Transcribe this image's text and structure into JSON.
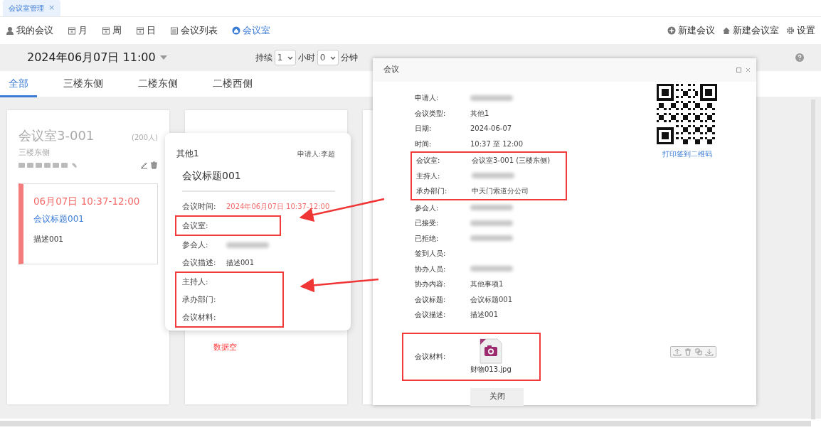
{
  "app_tabs": [
    {
      "label": "会议室管理",
      "close": "×",
      "selected": true
    }
  ],
  "toolbar": {
    "left": [
      {
        "label": "我的会议",
        "selected": false
      },
      {
        "label": "月",
        "selected": false
      },
      {
        "label": "周",
        "selected": false
      },
      {
        "label": "日",
        "selected": false
      },
      {
        "label": "会议列表",
        "selected": false
      },
      {
        "label": "会议室",
        "selected": true
      }
    ],
    "right": [
      {
        "label": "新建会议"
      },
      {
        "label": "新建会议室"
      },
      {
        "label": "设置"
      }
    ]
  },
  "date_picker": {
    "value": "2024年06月07日 11:00"
  },
  "duration": {
    "label": "持续",
    "hours": "1",
    "hours_unit": "小时",
    "minutes": "0",
    "minutes_unit": "分钟"
  },
  "location_tabs": [
    {
      "label": "全部",
      "selected": true
    },
    {
      "label": "三楼东侧",
      "selected": false
    },
    {
      "label": "二楼东侧",
      "selected": false
    },
    {
      "label": "二楼西侧",
      "selected": false
    }
  ],
  "rooms": [
    {
      "name": "会议室3-001",
      "capacity": "(200人)",
      "location": "三楼东侧",
      "meetings": [
        {
          "time": "06月07日 10:37-12:00",
          "title": "会议标题001",
          "description": "描述001"
        }
      ]
    },
    {
      "empty_text": "数据空"
    }
  ],
  "popup": {
    "type": "其他1",
    "applicant": "申请人:李超",
    "title": "会议标题001",
    "sections": [
      {
        "fields": [
          {
            "label": "会议时间:",
            "value": "2024年06月07日 10:37-12:00",
            "kind": "highlight"
          }
        ]
      },
      {
        "boxed": true,
        "fields": [
          {
            "label": "会议室:"
          }
        ]
      },
      {
        "fields": [
          {
            "label": "参会人:",
            "blurred": true
          },
          {
            "label": "会议描述:",
            "value": "描述001"
          }
        ]
      },
      {
        "boxed": true,
        "fields": [
          {
            "label": "主持人:"
          },
          {
            "label": "承办部门:"
          },
          {
            "label": "会议材料:"
          }
        ]
      }
    ]
  },
  "dialog": {
    "title": "会议",
    "sections": [
      {
        "fields": [
          {
            "label": "申请人:",
            "blurred": true
          },
          {
            "label": "会议类型:",
            "value": "其他1"
          },
          {
            "label": "日期:",
            "value": "2024-06-07"
          },
          {
            "label": "时间:",
            "value": "10:37 至 12:00"
          }
        ]
      },
      {
        "boxed": true,
        "fields": [
          {
            "label": "会议室:",
            "value": "会议室3-001 (三楼东侧)"
          },
          {
            "label": "主持人:",
            "blurred": true
          },
          {
            "label": "承办部门:",
            "value": "中天门索道分公司"
          }
        ]
      },
      {
        "fields": [
          {
            "label": "参会人:",
            "blurred": true
          },
          {
            "label": "已接受:",
            "blurred": true
          },
          {
            "label": "已拒绝:",
            "blurred": true
          },
          {
            "label": "签到人员:"
          },
          {
            "label": "协办人员:",
            "blurred": true
          },
          {
            "label": "协办内容:",
            "value": "其他事项1"
          },
          {
            "label": "会议标题:",
            "value": "会议标题001"
          },
          {
            "label": "会议描述:",
            "value": "描述001"
          }
        ]
      }
    ],
    "attachment": {
      "boxed": true,
      "label": "会议材料:",
      "file": "财物013.jpg"
    },
    "qr_link": "打印签到二维码",
    "close_button": "关闭"
  }
}
